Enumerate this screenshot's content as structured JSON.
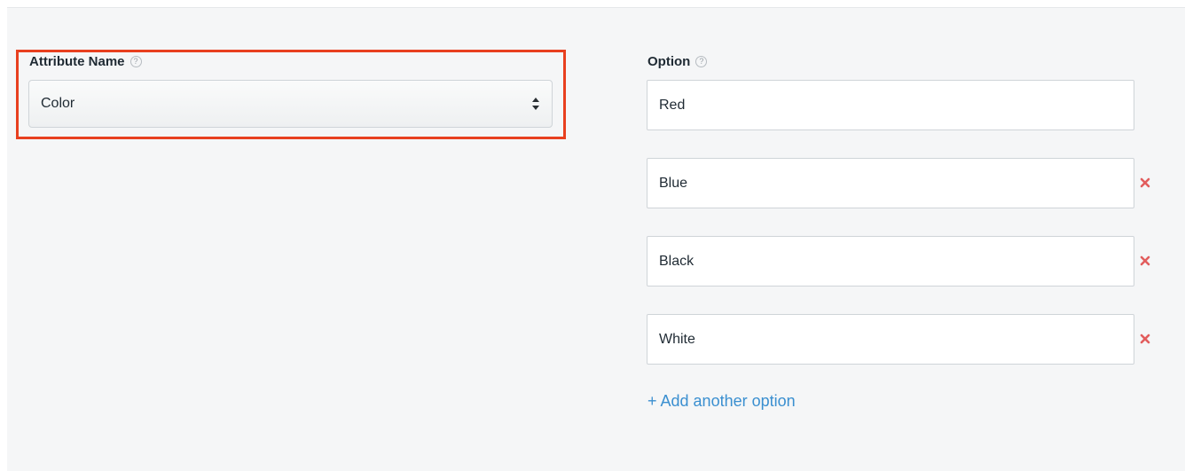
{
  "attribute": {
    "label": "Attribute Name",
    "help_icon": "question-circle-icon",
    "selected_value": "Color",
    "select_arrow_icon": "sort-arrows-icon",
    "highlight_color": "#e8401f"
  },
  "options": {
    "label": "Option",
    "help_icon": "question-circle-icon",
    "values": [
      "Red",
      "Blue",
      "Black",
      "White"
    ],
    "remove_icon": "remove-x-icon",
    "remove_color": "#e25d5d",
    "add_label": "+ Add another option",
    "link_color": "#3a8fd0"
  }
}
